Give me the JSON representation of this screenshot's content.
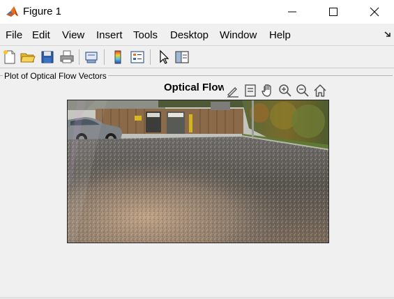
{
  "window": {
    "title": "Figure 1",
    "app_icon": "matlab-icon",
    "controls": [
      "minimize-icon",
      "maximize-icon",
      "close-icon"
    ]
  },
  "menubar": {
    "items": [
      "File",
      "Edit",
      "View",
      "Insert",
      "Tools",
      "Desktop",
      "Window",
      "Help"
    ],
    "dock_icon": "dock-arrow-icon"
  },
  "toolbar": {
    "buttons": [
      "new-figure-icon",
      "open-file-icon",
      "save-icon",
      "print-icon",
      "link-plot-icon",
      "colorbar-icon",
      "legend-icon",
      "pointer-icon",
      "property-inspector-icon"
    ]
  },
  "panel": {
    "title": "Plot of Optical Flow Vectors"
  },
  "axes": {
    "title": "Optical Flow",
    "toolbar": [
      "brush-icon",
      "data-tips-icon",
      "pan-icon",
      "zoom-in-icon",
      "zoom-out-icon",
      "home-icon"
    ],
    "image_description": "parking-lot-scene"
  },
  "colors": {
    "title_bar": "#ffffff",
    "background": "#f0f0f0",
    "accent_orange": "#e8701a"
  }
}
